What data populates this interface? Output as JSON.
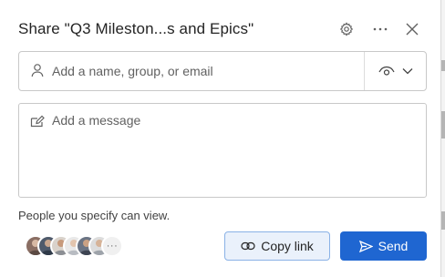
{
  "dialog": {
    "title": "Share \"Q3 Mileston...s and Epics\"",
    "settings_icon": "gear-icon",
    "more_icon": "more-horizontal-icon",
    "close_icon": "close-icon"
  },
  "recipient": {
    "placeholder": "Add a name, group, or email",
    "value": "",
    "icon": "person-icon",
    "permission_icon": "eye-icon",
    "dropdown_icon": "chevron-down-icon"
  },
  "message": {
    "placeholder": "Add a message",
    "value": "",
    "icon": "edit-icon"
  },
  "permission_note": "People you specify can view.",
  "avatars": {
    "more_label": "···"
  },
  "actions": {
    "copy_link_label": "Copy link",
    "copy_link_icon": "link-icon",
    "send_label": "Send",
    "send_icon": "send-icon"
  },
  "colors": {
    "accent": "#1f66d1",
    "copy_bg": "#eaf1fb",
    "copy_border": "#8ab2e6"
  }
}
